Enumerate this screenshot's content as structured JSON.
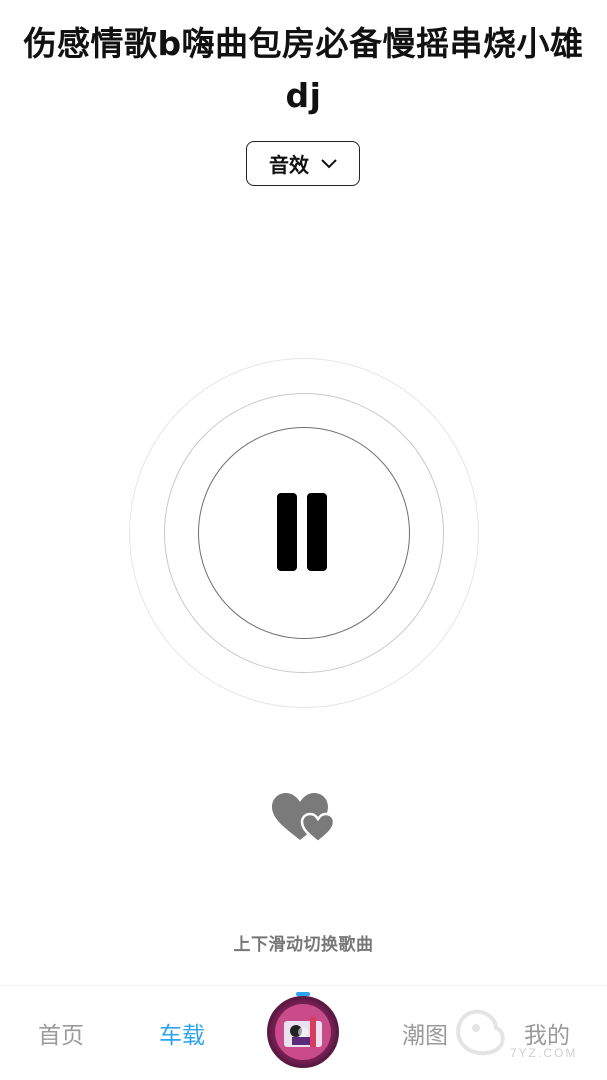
{
  "player": {
    "title": "伤感情歌b嗨曲包房必备慢摇串烧小雄dj",
    "effect_label": "音效",
    "swipe_hint": "上下滑动切换歌曲"
  },
  "tabbar": {
    "home": "首页",
    "car": "车载",
    "trend": "潮图",
    "mine": "我的",
    "active_color": "#2ea3f2",
    "inactive_color": "#9a9a9a"
  },
  "watermark": {
    "text": "7YZ.COM"
  }
}
